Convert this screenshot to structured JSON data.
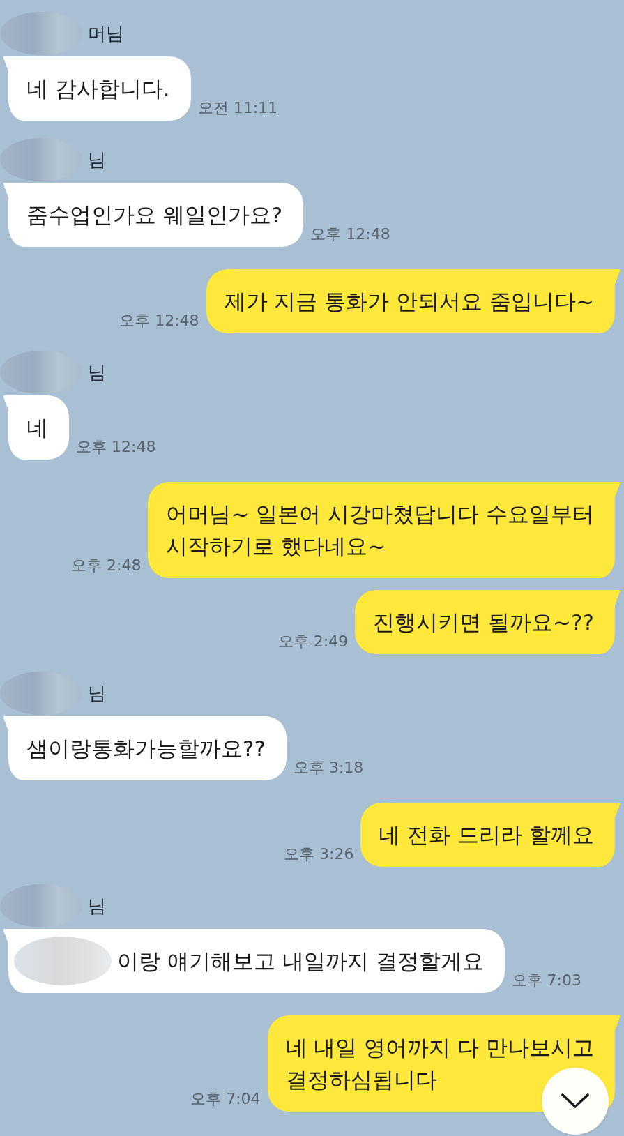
{
  "chat": {
    "messages": [
      {
        "kind": "incoming",
        "sender": "머님",
        "sender_redacted": true,
        "text": "네 감사합니다.",
        "text_redacted": false,
        "time": "오전 11:11"
      },
      {
        "kind": "incoming",
        "sender": "님",
        "sender_redacted": true,
        "text": "줌수업인가요 웨일인가요?",
        "text_redacted": false,
        "time": "오후 12:48"
      },
      {
        "kind": "outgoing",
        "text": "제가 지금 통화가 안되서요 줌입니다~",
        "text_redacted": false,
        "time": "오후 12:48"
      },
      {
        "kind": "incoming",
        "sender": "님",
        "sender_redacted": true,
        "text": "네",
        "text_redacted": false,
        "time": "오후 12:48"
      },
      {
        "kind": "outgoing",
        "text": "어머님~ 일본어 시강마쳤답니다 수요일부터\n시작하기로 했다네요~",
        "text_redacted": false,
        "time": "오후 2:48"
      },
      {
        "kind": "outgoing",
        "text": "진행시키면 될까요~??",
        "text_redacted": false,
        "time": "오후 2:49"
      },
      {
        "kind": "incoming",
        "sender": "님",
        "sender_redacted": true,
        "text": "샘이랑통화가능할까요??",
        "text_redacted": false,
        "time": "오후 3:18"
      },
      {
        "kind": "outgoing",
        "text": "네 전화 드리라 할께요",
        "text_redacted": false,
        "time": "오후 3:26"
      },
      {
        "kind": "incoming",
        "sender": "님",
        "sender_redacted": true,
        "text": "이랑 얘기해보고 내일까지 결정할게요",
        "text_redacted": true,
        "time": "오후 7:03"
      },
      {
        "kind": "outgoing",
        "text": "네 내일 영어까지 다 만나보시고\n결정하심됩니다",
        "text_redacted": false,
        "time": "오후 7:04"
      }
    ]
  }
}
